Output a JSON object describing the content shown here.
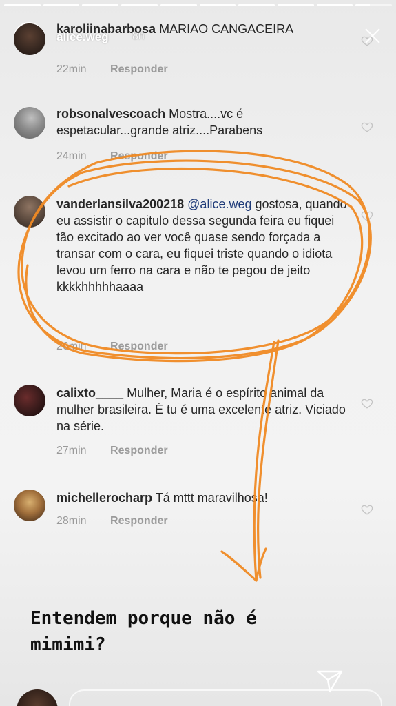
{
  "story": {
    "username": "alice.weg",
    "time": "8h",
    "segments_total": 10,
    "segments_viewed": 9
  },
  "comments": [
    {
      "username": "karoliinabarbosa",
      "text": "MARIAO CANGACEIRA",
      "time": "22min",
      "reply_label": "Responder",
      "liked": true
    },
    {
      "username": "robsonalvescoach",
      "text": "Mostra....vc é espetacular...grande atriz....Parabens",
      "time": "24min",
      "reply_label": "Responder",
      "liked": false
    },
    {
      "username": "vanderlansilva200218",
      "mention": "@alice.weg",
      "text": "gostosa, quando eu assistir o capitulo dessa segunda feira eu fiquei tão excitado ao ver você quase sendo forçada a transar com o cara, eu fiquei triste quando o idiota levou um ferro na cara e não te pegou de jeito kkkkhhhhhaaaa",
      "time": "26min",
      "reply_label": "Responder",
      "liked": false
    },
    {
      "username": "calixto____",
      "text": "Mulher, Maria é o espírito animal da mulher brasileira. É tu é uma excelente atriz. Viciado na série.",
      "time": "27min",
      "reply_label": "Responder",
      "liked": false
    },
    {
      "username": "michellerocharp",
      "text": "Tá mttt maravilhosa!",
      "time": "28min",
      "reply_label": "Responder",
      "liked": false
    }
  ],
  "caption": {
    "line1": "Entendem porque não é",
    "line2": "mimimi?"
  },
  "icons": {
    "close": "close-icon",
    "send": "send-icon",
    "heart": "heart-icon"
  },
  "colors": {
    "annotation": "#f08a24",
    "meta_text": "#9a9a9a",
    "mention": "#1e3a78"
  }
}
